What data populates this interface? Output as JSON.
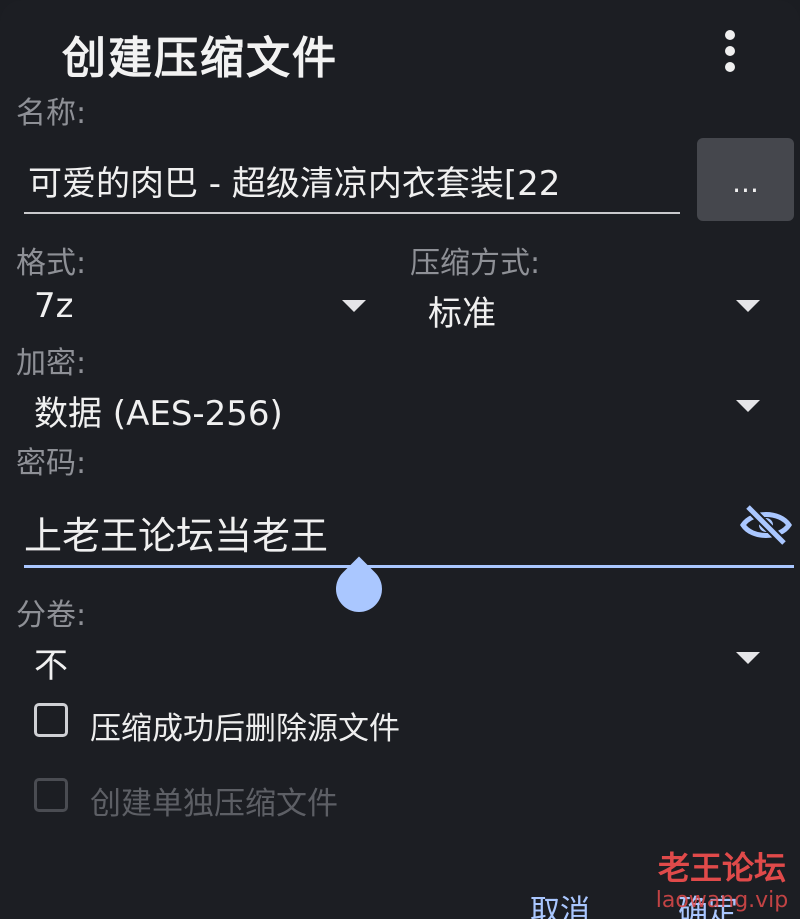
{
  "dialog": {
    "title": "创建压缩文件",
    "menu_icon": "more-vert-icon"
  },
  "name": {
    "label": "名称:",
    "value": "可爱的肉巴 - 超级清凉内衣套装[22",
    "browse_label": "..."
  },
  "format": {
    "label": "格式:",
    "value": "7z"
  },
  "compression": {
    "label": "压缩方式:",
    "value": "标准"
  },
  "encryption": {
    "label": "加密:",
    "value": "数据 (AES-256)"
  },
  "password": {
    "label": "密码:",
    "value": "上老王论坛当老王",
    "toggle_icon": "eye-off-icon",
    "accent": "#aac7ff"
  },
  "split": {
    "label": "分卷:",
    "value": "不"
  },
  "options": {
    "delete_source": {
      "label": "压缩成功后删除源文件",
      "checked": false
    },
    "separate_archives": {
      "label": "创建单独压缩文件",
      "checked": false,
      "enabled": false
    }
  },
  "actions": {
    "cancel": "取消",
    "ok": "确定"
  },
  "watermark": {
    "line1": "老王论坛",
    "line2": "laowang.vip"
  }
}
